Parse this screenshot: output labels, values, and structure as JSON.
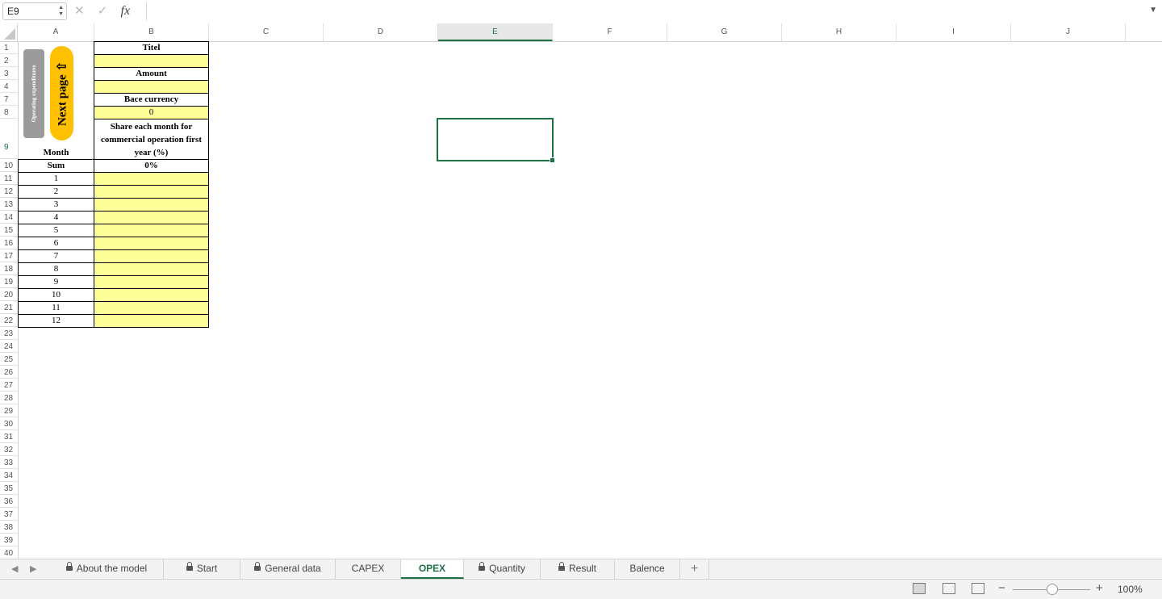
{
  "formula_bar": {
    "name_box": "E9",
    "cancel_icon": "✕",
    "enter_icon": "✓",
    "fx_label": "fx",
    "formula": ""
  },
  "columns": [
    "A",
    "B",
    "C",
    "D",
    "E",
    "F",
    "G",
    "H",
    "I",
    "J"
  ],
  "selected_column": "E",
  "rows": [
    "1",
    "2",
    "3",
    "4",
    "7",
    "8",
    "9",
    "10",
    "11",
    "12",
    "13",
    "14",
    "15",
    "16",
    "17",
    "18",
    "19",
    "20",
    "21",
    "22",
    "23",
    "24",
    "25",
    "26",
    "27",
    "28",
    "29",
    "30",
    "31",
    "32",
    "33",
    "34",
    "35",
    "36",
    "37",
    "38",
    "39",
    "40"
  ],
  "selected_row": "9",
  "cells": {
    "titel_label": "Titel",
    "amount_label": "Amount",
    "base_currency_label": "Bace currency",
    "base_currency_value": "0",
    "share_label": "Share each month for commercial operation first year (%)",
    "month_label": "Month",
    "sum_label": "Sum",
    "sum_value": "0%",
    "months": [
      "1",
      "2",
      "3",
      "4",
      "5",
      "6",
      "7",
      "8",
      "9",
      "10",
      "11",
      "12"
    ]
  },
  "buttons": {
    "operating_expenditures": "Operating expenditures",
    "next_page": "Next page ⇧"
  },
  "sheet_tabs": [
    {
      "label": "About the model",
      "locked": true
    },
    {
      "label": "Start",
      "locked": true
    },
    {
      "label": "General data",
      "locked": true
    },
    {
      "label": "CAPEX",
      "locked": false
    },
    {
      "label": "OPEX",
      "locked": false,
      "active": true
    },
    {
      "label": "Quantity",
      "locked": true
    },
    {
      "label": "Result",
      "locked": true
    },
    {
      "label": "Balence",
      "locked": false
    }
  ],
  "add_sheet_label": "+",
  "status": {
    "zoom_minus": "−",
    "zoom_plus": "+",
    "zoom_level": "100%"
  },
  "colors": {
    "accent": "#1e7145",
    "input_fill": "#ffff99",
    "next_button": "#ffc000",
    "title_button": "#9b9b9b"
  }
}
